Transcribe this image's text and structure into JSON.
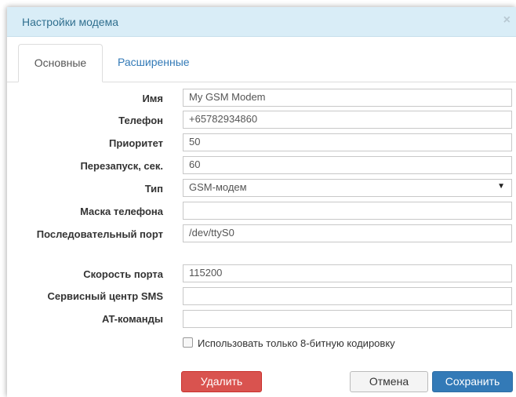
{
  "dialog": {
    "title": "Настройки модема",
    "close_glyph": "×"
  },
  "tabs": [
    {
      "label": "Основные",
      "active": true
    },
    {
      "label": "Расширенные",
      "active": false
    }
  ],
  "fields": {
    "name": {
      "label": "Имя",
      "value": "My GSM Modem"
    },
    "phone": {
      "label": "Телефон",
      "value": "+65782934860"
    },
    "priority": {
      "label": "Приоритет",
      "value": "50"
    },
    "restart": {
      "label": "Перезапуск, сек.",
      "value": "60"
    },
    "type": {
      "label": "Тип",
      "value": "GSM-модем",
      "arrow": "▼"
    },
    "phone_mask": {
      "label": "Маска телефона",
      "value": ""
    },
    "serial_port": {
      "label": "Последовательный порт",
      "value": "/dev/ttyS0"
    },
    "port_speed": {
      "label": "Скорость порта",
      "value": "115200"
    },
    "sms_center": {
      "label": "Сервисный центр SMS",
      "value": ""
    },
    "at_commands": {
      "label": "AT-команды",
      "value": ""
    }
  },
  "checkbox_8bit": {
    "label": "Использовать только 8-битную кодировку",
    "checked": false
  },
  "buttons": {
    "delete": "Удалить",
    "cancel": "Отмена",
    "save": "Сохранить"
  },
  "colors": {
    "header_bg": "#d9edf7",
    "danger": "#d9534f",
    "primary": "#337ab7"
  }
}
